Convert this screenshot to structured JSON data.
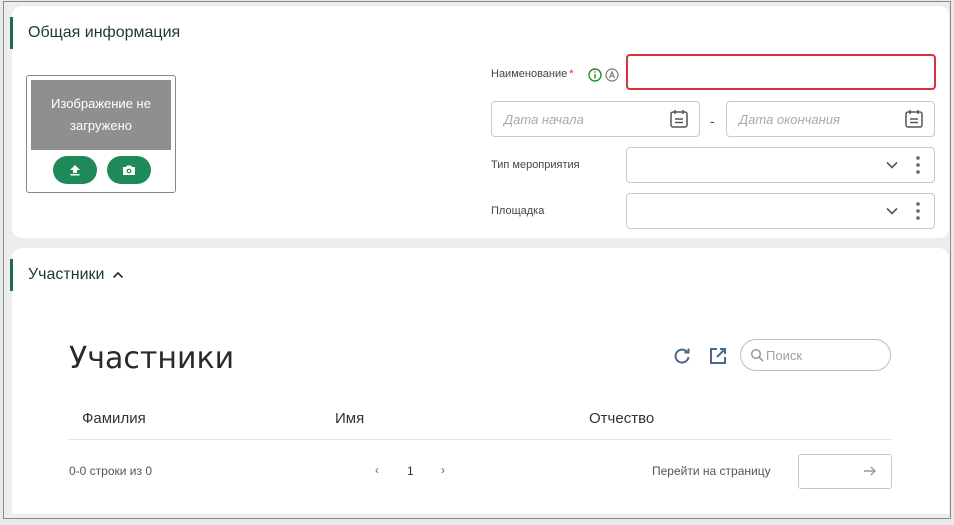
{
  "general": {
    "section_title": "Общая информация",
    "image_placeholder": "Изображение не загружено",
    "name_label": "Наименование",
    "required_mark": "*",
    "name_value": "",
    "start_date_placeholder": "Дата начала",
    "range_separator": "-",
    "end_date_placeholder": "Дата окончания",
    "event_type_label": "Тип мероприятия",
    "event_type_value": "",
    "venue_label": "Площадка",
    "venue_value": ""
  },
  "members": {
    "section_title": "Участники",
    "table_title": "Участники",
    "search_placeholder": "Поиск",
    "columns": [
      "Фамилия",
      "Имя",
      "Отчество"
    ],
    "rows": [],
    "row_count_text": "0-0 строки из 0",
    "current_page": "1",
    "goto_page_label": "Перейти на страницу",
    "goto_page_value": ""
  },
  "colors": {
    "accent_green": "#1e8a5a",
    "section_border": "#1e6e4e",
    "error_red": "#d9343a",
    "placeholder_gray": "#8f8f8f"
  },
  "icons": {
    "upload": "upload-icon",
    "camera": "camera-icon",
    "info": "info-icon",
    "auto": "auto-icon",
    "calendar": "calendar-icon",
    "dropdown": "chevron-down-icon",
    "more": "more-vertical-icon",
    "refresh": "refresh-icon",
    "export": "external-link-icon",
    "search": "search-icon",
    "collapse": "chevron-up-icon"
  }
}
